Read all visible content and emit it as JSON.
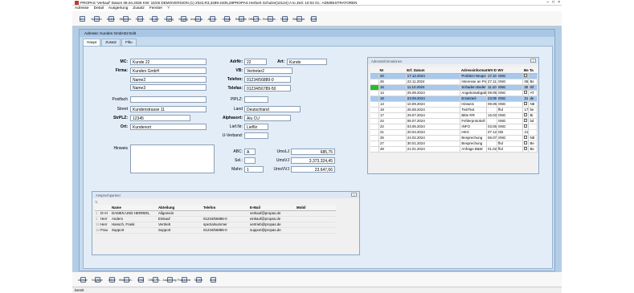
{
  "titlebar": {
    "text": "PROPAS 'Verkauf'   Datum 08.04.2025 KW: 15/25    DEMOVERSION (1) 2022,R3,3289-2405,28PROPAS Herbert Schulze(10124) A to Zeit: 10:04 Gr.: ADMINISTRATOREN"
  },
  "menu": [
    "Adresse",
    "Detail",
    "Ausgertung",
    "Zusatz",
    "Fenster",
    "?"
  ],
  "toolbar": [
    {
      "label": "Neu",
      "icon": "new-icon"
    },
    {
      "label": "Speichen",
      "icon": "save-icon"
    },
    {
      "label": "Ändern",
      "icon": "edit-icon"
    },
    {
      "label": "Bildschirm",
      "icon": "screen-icon"
    },
    {
      "label": "Suchen",
      "icon": "search-icon"
    },
    {
      "label": "Drucken",
      "icon": "print-icon"
    },
    {
      "label": "Vorgang",
      "icon": "process-icon"
    },
    {
      "label": "Vorgang",
      "icon": "process-icon"
    },
    {
      "label": "Ansprechp...",
      "icon": "contact-icon"
    },
    {
      "label": "Adr.Info",
      "icon": "info-icon"
    },
    {
      "label": "Umsatz",
      "icon": "chart-icon"
    },
    {
      "label": "Belegliste",
      "icon": "list-icon"
    },
    {
      "label": "Office-Rec...",
      "icon": "office-icon"
    },
    {
      "label": "Technische...",
      "icon": "tech-icon"
    },
    {
      "label": "Telefon",
      "icon": "phone-icon"
    },
    {
      "label": "Wiedervorl.",
      "icon": "reminder-icon"
    },
    {
      "label": "Ende",
      "icon": "exit-icon"
    }
  ],
  "main_window": {
    "title": "Adresse: Kunden GmbH22  Edit",
    "tabs": [
      "Haupt",
      "Zusatz",
      "Filtu"
    ]
  },
  "form": {
    "mc_label": "MC:",
    "mc": "Kunde 22",
    "firma_label": "Firma:",
    "firma": "Kunden GmbH",
    "name2": "Name2",
    "name3": "Name3",
    "postfach_label": "Postfach",
    "street_label": "Street",
    "street": "Kundenstrasse 11",
    "strplz_label": "StrPLZ:",
    "strplz": "12345",
    "ort_label": "Ort:",
    "ort": "Kundenort",
    "adrnr_label": "AdrNr:",
    "adrnr": "22",
    "art_label": "Art:",
    "art": "Kunde",
    "vb_label": "VB:",
    "vb": "Vertreter2",
    "telefon_label": "Telefon:",
    "telefon": "01234/56889-0",
    "telefax_label": "Telefax:",
    "telefax": "01234/56789-50",
    "pplz_label": "PlPLZ:",
    "land_label": "Land",
    "land": "Deutschland",
    "alphasort_label": "Alphasort:",
    "alphasort": "Alu CU",
    "liefnr_label": "Lief.Nr:",
    "liefnr": "LiefNr",
    "uverband_label": "U-Verband:",
    "hinweis_label": "Hinweis",
    "abc_label": "ABC:",
    "abc": "A",
    "sel_label": "Sel.:",
    "mahn_label": "Mahn:",
    "mahn": "1",
    "umslj_label": "UmsLJ",
    "umslj": "685,75",
    "umsvj_label": "UmsVJ",
    "umsvj": "3.373.324,45",
    "umsvvj_label": "UmsVVJ",
    "umsvvj": "23.647,66"
  },
  "adr_info": {
    "title": "Adressinformationen",
    "headers": [
      "Nr",
      "Erf. Datum",
      "Adressinformation",
      "WV-Datum",
      "WV",
      "Bearbeitermi",
      "Ta"
    ],
    "rows": [
      [
        "20",
        "17.12.2024",
        "Problem Neuprodukt",
        "17.10.2024",
        "SNG",
        "",
        "",
        "sel"
      ],
      [
        "26",
        "22.11.2024",
        "Interesse an Produkt XY",
        "27.11.2024",
        "SNG",
        "06.03.2024",
        "Bs",
        ""
      ],
      [
        "16",
        "11.10.2024",
        "Schaden Bodenplatte",
        "11.10.2024",
        "SNG",
        "30.08.2024",
        "Isf",
        "selhl"
      ],
      [
        "14",
        "25.09.2024",
        "Angebotsabgabe?",
        "09.05.2024",
        "SNG",
        "",
        "AT",
        ""
      ],
      [
        "18",
        "23.09.2024",
        "Ersatzteil",
        "23.09.2024",
        "SNG",
        "21.10.2024",
        "de",
        "sel"
      ],
      [
        "13",
        "10.09.2024",
        "Hinweis",
        "09.05.2024",
        "SNG",
        "",
        "NE",
        ""
      ],
      [
        "19",
        "25.08.2024",
        "TestText",
        "",
        "fhd",
        "17.12.2024",
        "be",
        ""
      ],
      [
        "17",
        "29.07.2024",
        "Bitte RR",
        "16.03.2024",
        "SNG",
        "",
        "Bi",
        ""
      ],
      [
        "24",
        "06.07.2024",
        "Fehlerprotokoll",
        "",
        "SNG",
        "",
        "bd",
        ""
      ],
      [
        "22",
        "03.05.2024",
        "INFO",
        "03.05.2024",
        "SNG",
        "",
        "",
        ""
      ],
      [
        "21",
        "20.04.2024",
        "HKG",
        "07.12.2024",
        "GB",
        "21.01.2024",
        "",
        ""
      ],
      [
        "25",
        "24.02.2024",
        "Besprechung",
        "06.07.2024",
        "SNG",
        "",
        "NE",
        ""
      ],
      [
        "27",
        "30.01.2024",
        "Besprechung",
        "",
        "fhd",
        "",
        "Be",
        ""
      ],
      [
        "28",
        "21.01.2024",
        "Anfrage B&M",
        "01.02.2024",
        "fhd",
        "",
        "Be",
        ""
      ]
    ]
  },
  "contacts": {
    "title": "Ansprechpartner",
    "headers": [
      "",
      "Name",
      "Abteilung",
      "Telefon",
      "E-Mail",
      "Mobil"
    ],
    "rows": [
      [
        "D+H",
        "DAMEN UND HERREN,",
        "Allgemein",
        "",
        "verkauf@propas.de",
        ""
      ],
      [
        "Herr",
        "Anders",
        "Einkauf",
        "01234/56885-0",
        "einkauf@propas.de",
        ""
      ],
      [
        "Herr",
        "Hansch, Frank",
        "Vertrieb",
        "spezialnummer",
        "vertrieb@propas.de",
        ""
      ],
      [
        "Frau",
        "Support",
        "Support",
        "01234/56885-0",
        "support@propas.de",
        ""
      ]
    ],
    "row_nums": [
      "1",
      "1",
      "100",
      "100"
    ]
  },
  "bottombar": [
    {
      "label": "Adresse",
      "icon": "address-icon"
    },
    {
      "label": "Vorgänge",
      "icon": "process-icon"
    },
    {
      "label": "Artikel",
      "icon": "article-icon"
    },
    {
      "label": "Wiedervorl...",
      "icon": "reminder-icon"
    },
    {
      "label": "Detail",
      "icon": "detail-icon"
    },
    {
      "label": "Office-Pro...",
      "icon": "office-icon"
    },
    {
      "label": "Auswertung",
      "icon": "report-icon"
    },
    {
      "label": "Programme",
      "icon": "program-icon"
    },
    {
      "label": "System",
      "icon": "system-icon"
    },
    {
      "label": "Ende",
      "icon": "exit-icon"
    }
  ],
  "status": "bereit"
}
